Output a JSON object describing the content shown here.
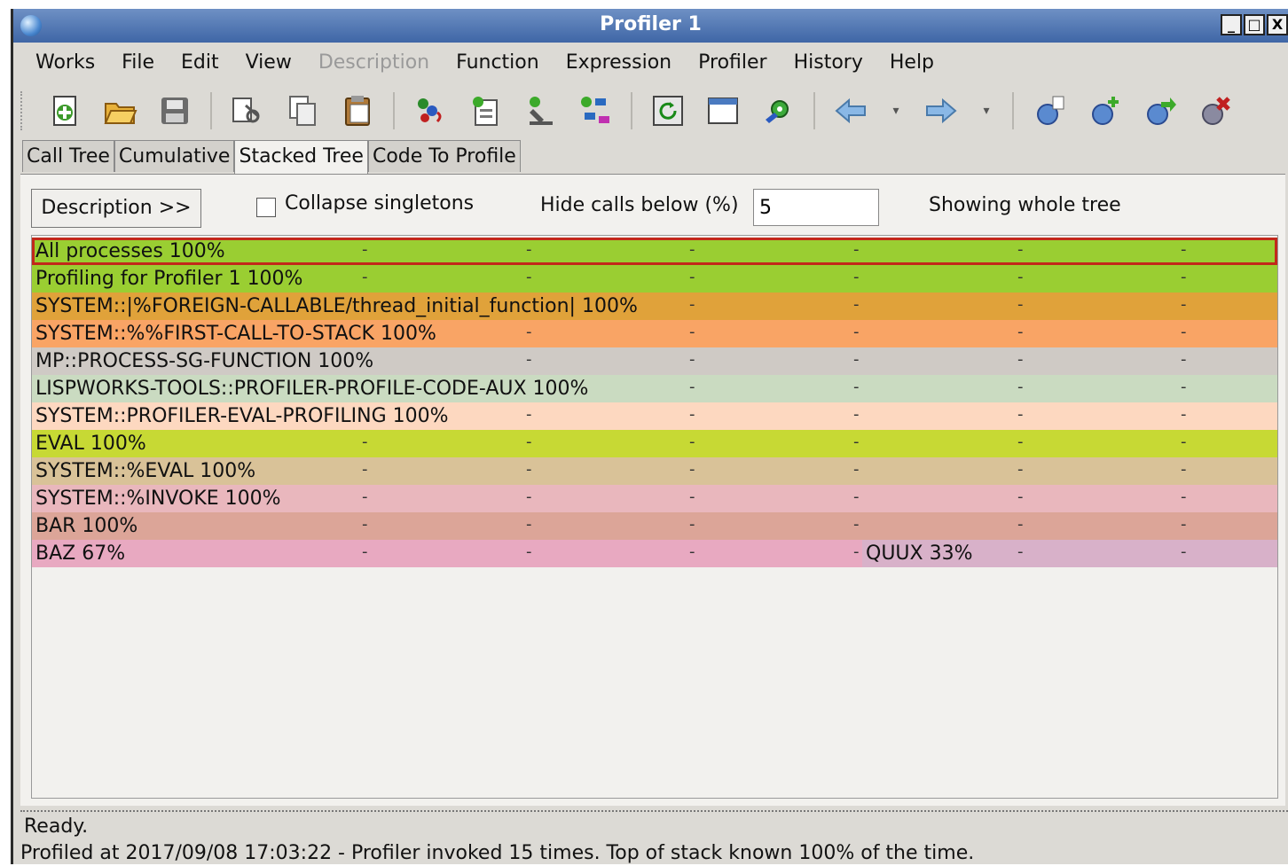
{
  "window": {
    "title": "Profiler 1",
    "controls": {
      "minimize": "_",
      "maximize": "□",
      "close": "X"
    }
  },
  "menubar": [
    "Works",
    "File",
    "Edit",
    "View",
    "Description",
    "Function",
    "Expression",
    "Profiler",
    "History",
    "Help"
  ],
  "menubar_disabled": [
    "Description"
  ],
  "toolbar_icons": [
    "new-icon",
    "open-icon",
    "save-icon",
    "cut-icon",
    "copy-icon",
    "paste-icon",
    "profile-icon",
    "inspect-icon",
    "debug-icon",
    "tree-icon",
    "refresh-icon",
    "window-icon",
    "settings-icon",
    "back-icon",
    "forward-icon",
    "profiler-start-icon",
    "profiler-add-icon",
    "profiler-go-icon",
    "profiler-stop-icon"
  ],
  "tabs": [
    "Call Tree",
    "Cumulative",
    "Stacked Tree",
    "Code To Profile"
  ],
  "active_tab": "Stacked Tree",
  "controls": {
    "description_button": "Description >>",
    "collapse_label": "Collapse singletons",
    "collapse_checked": false,
    "hide_label": "Hide calls below (%)",
    "hide_value": "5",
    "showing": "Showing whole tree"
  },
  "stacked_tree": [
    {
      "cells": [
        {
          "label": "All processes 100%",
          "span": 1.0,
          "color": "#9ace32",
          "selected": true
        }
      ]
    },
    {
      "cells": [
        {
          "label": "Profiling for Profiler 1 100%",
          "span": 1.0,
          "color": "#9ace32"
        }
      ]
    },
    {
      "cells": [
        {
          "label": "SYSTEM::|%FOREIGN-CALLABLE/thread_initial_function| 100%",
          "span": 1.0,
          "color": "#e0a23a"
        }
      ]
    },
    {
      "cells": [
        {
          "label": "SYSTEM::%%FIRST-CALL-TO-STACK 100%",
          "span": 1.0,
          "color": "#f9a465"
        }
      ]
    },
    {
      "cells": [
        {
          "label": "MP::PROCESS-SG-FUNCTION 100%",
          "span": 1.0,
          "color": "#cfcac5"
        }
      ]
    },
    {
      "cells": [
        {
          "label": "LISPWORKS-TOOLS::PROFILER-PROFILE-CODE-AUX 100%",
          "span": 1.0,
          "color": "#cadbc1"
        }
      ]
    },
    {
      "cells": [
        {
          "label": "SYSTEM::PROFILER-EVAL-PROFILING 100%",
          "span": 1.0,
          "color": "#fdd8c0"
        }
      ]
    },
    {
      "cells": [
        {
          "label": "EVAL 100%",
          "span": 1.0,
          "color": "#c7d934"
        }
      ]
    },
    {
      "cells": [
        {
          "label": "SYSTEM::%EVAL 100%",
          "span": 1.0,
          "color": "#d9c298"
        }
      ]
    },
    {
      "cells": [
        {
          "label": "SYSTEM::%INVOKE 100%",
          "span": 1.0,
          "color": "#e9b7bd"
        }
      ]
    },
    {
      "cells": [
        {
          "label": "BAR 100%",
          "span": 1.0,
          "color": "#dca598"
        }
      ]
    },
    {
      "cells": [
        {
          "label": "BAZ 67%",
          "span": 0.667,
          "color": "#e8a9c1"
        },
        {
          "label": "QUUX 33%",
          "span": 0.333,
          "color": "#d8b1c9"
        }
      ]
    }
  ],
  "status": {
    "line1": "Ready.",
    "line2": "Profiled at 2017/09/08 17:03:22 - Profiler invoked 15 times. Top of stack known 100% of the time."
  }
}
